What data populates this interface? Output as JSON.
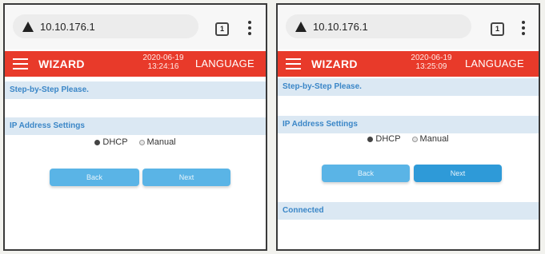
{
  "screens": [
    {
      "url": "10.10.176.1",
      "tabs_count": "1",
      "app_title": "WIZARD",
      "date": "2020-06-19",
      "time": "13:24:16",
      "language_label": "LANGUAGE",
      "step_heading": "Step-by-Step Please.",
      "ip_heading": "IP Address Settings",
      "radio_dhcp": "DHCP",
      "radio_manual": "Manual",
      "back_label": "Back",
      "next_label": "Next",
      "status": ""
    },
    {
      "url": "10.10.176.1",
      "tabs_count": "1",
      "app_title": "WIZARD",
      "date": "2020-06-19",
      "time": "13:25:09",
      "language_label": "LANGUAGE",
      "step_heading": "Step-by-Step Please.",
      "ip_heading": "IP Address Settings",
      "radio_dhcp": "DHCP",
      "radio_manual": "Manual",
      "back_label": "Back",
      "next_label": "Next",
      "status": "Connected"
    }
  ],
  "colors": {
    "appbar": "#e83a2a",
    "section_bar": "#dbe8f3",
    "section_text": "#3a86c7",
    "button": "#5ab4e6"
  }
}
